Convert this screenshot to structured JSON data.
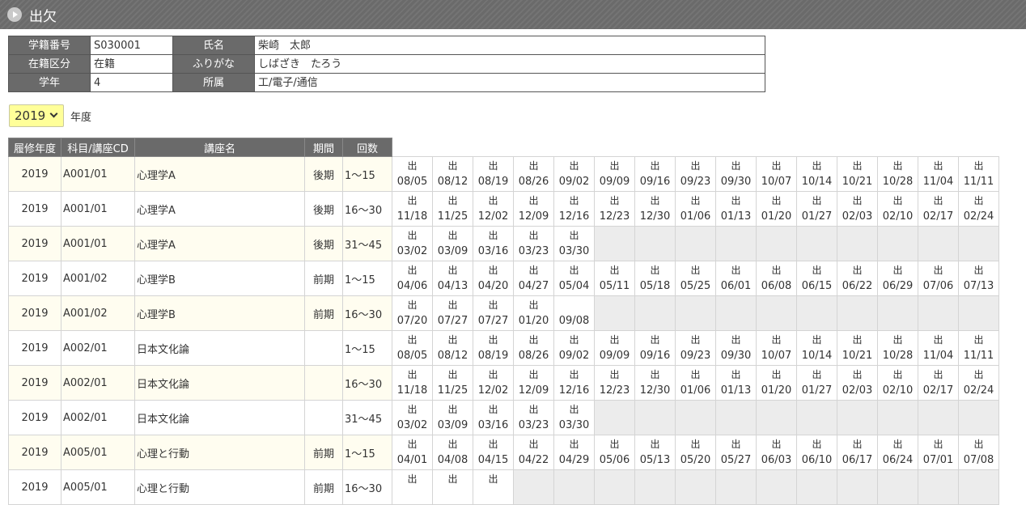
{
  "header": {
    "title": "出欠"
  },
  "student": {
    "id_label": "学籍番号",
    "id": "S030001",
    "name_label": "氏名",
    "name": "柴崎　太郎",
    "status_label": "在籍区分",
    "status": "在籍",
    "kana_label": "ふりがな",
    "kana": "しばざき　たろう",
    "grade_label": "学年",
    "grade": "4",
    "affiliation_label": "所属",
    "affiliation": "工/電子/通信"
  },
  "year_select": {
    "value": "2019",
    "label": "年度"
  },
  "table": {
    "headers": [
      "履修年度",
      "科目/講座CD",
      "講座名",
      "期間",
      "回数"
    ],
    "rows": [
      {
        "year": "2019",
        "code": "A001/01",
        "name": "心理学A",
        "term": "後期",
        "range": "1～15",
        "marks": [
          [
            "出",
            "08/05"
          ],
          [
            "出",
            "08/12"
          ],
          [
            "出",
            "08/19"
          ],
          [
            "出",
            "08/26"
          ],
          [
            "出",
            "09/02"
          ],
          [
            "出",
            "09/09"
          ],
          [
            "出",
            "09/16"
          ],
          [
            "出",
            "09/23"
          ],
          [
            "出",
            "09/30"
          ],
          [
            "出",
            "10/07"
          ],
          [
            "出",
            "10/14"
          ],
          [
            "出",
            "10/21"
          ],
          [
            "出",
            "10/28"
          ],
          [
            "出",
            "11/04"
          ],
          [
            "出",
            "11/11"
          ]
        ]
      },
      {
        "year": "2019",
        "code": "A001/01",
        "name": "心理学A",
        "term": "後期",
        "range": "16～30",
        "marks": [
          [
            "出",
            "11/18"
          ],
          [
            "出",
            "11/25"
          ],
          [
            "出",
            "12/02"
          ],
          [
            "出",
            "12/09"
          ],
          [
            "出",
            "12/16"
          ],
          [
            "出",
            "12/23"
          ],
          [
            "出",
            "12/30"
          ],
          [
            "出",
            "01/06"
          ],
          [
            "出",
            "01/13"
          ],
          [
            "出",
            "01/20"
          ],
          [
            "出",
            "01/27"
          ],
          [
            "出",
            "02/03"
          ],
          [
            "出",
            "02/10"
          ],
          [
            "出",
            "02/17"
          ],
          [
            "出",
            "02/24"
          ]
        ]
      },
      {
        "year": "2019",
        "code": "A001/01",
        "name": "心理学A",
        "term": "後期",
        "range": "31～45",
        "marks": [
          [
            "出",
            "03/02"
          ],
          [
            "出",
            "03/09"
          ],
          [
            "出",
            "03/16"
          ],
          [
            "出",
            "03/23"
          ],
          [
            "出",
            "03/30"
          ]
        ]
      },
      {
        "year": "2019",
        "code": "A001/02",
        "name": "心理学B",
        "term": "前期",
        "range": "1～15",
        "marks": [
          [
            "出",
            "04/06"
          ],
          [
            "出",
            "04/13"
          ],
          [
            "出",
            "04/20"
          ],
          [
            "出",
            "04/27"
          ],
          [
            "出",
            "05/04"
          ],
          [
            "出",
            "05/11"
          ],
          [
            "出",
            "05/18"
          ],
          [
            "出",
            "05/25"
          ],
          [
            "出",
            "06/01"
          ],
          [
            "出",
            "06/08"
          ],
          [
            "出",
            "06/15"
          ],
          [
            "出",
            "06/22"
          ],
          [
            "出",
            "06/29"
          ],
          [
            "出",
            "07/06"
          ],
          [
            "出",
            "07/13"
          ]
        ]
      },
      {
        "year": "2019",
        "code": "A001/02",
        "name": "心理学B",
        "term": "前期",
        "range": "16～30",
        "marks": [
          [
            "出",
            "07/20"
          ],
          [
            "出",
            "07/27"
          ],
          [
            "出",
            "07/27"
          ],
          [
            "出",
            "01/20"
          ],
          [
            "",
            "09/08"
          ]
        ]
      },
      {
        "year": "2019",
        "code": "A002/01",
        "name": "日本文化論",
        "term": "",
        "range": "1～15",
        "marks": [
          [
            "出",
            "08/05"
          ],
          [
            "出",
            "08/12"
          ],
          [
            "出",
            "08/19"
          ],
          [
            "出",
            "08/26"
          ],
          [
            "出",
            "09/02"
          ],
          [
            "出",
            "09/09"
          ],
          [
            "出",
            "09/16"
          ],
          [
            "出",
            "09/23"
          ],
          [
            "出",
            "09/30"
          ],
          [
            "出",
            "10/07"
          ],
          [
            "出",
            "10/14"
          ],
          [
            "出",
            "10/21"
          ],
          [
            "出",
            "10/28"
          ],
          [
            "出",
            "11/04"
          ],
          [
            "出",
            "11/11"
          ]
        ]
      },
      {
        "year": "2019",
        "code": "A002/01",
        "name": "日本文化論",
        "term": "",
        "range": "16～30",
        "marks": [
          [
            "出",
            "11/18"
          ],
          [
            "出",
            "11/25"
          ],
          [
            "出",
            "12/02"
          ],
          [
            "出",
            "12/09"
          ],
          [
            "出",
            "12/16"
          ],
          [
            "出",
            "12/23"
          ],
          [
            "出",
            "12/30"
          ],
          [
            "出",
            "01/06"
          ],
          [
            "出",
            "01/13"
          ],
          [
            "出",
            "01/20"
          ],
          [
            "出",
            "01/27"
          ],
          [
            "出",
            "02/03"
          ],
          [
            "出",
            "02/10"
          ],
          [
            "出",
            "02/17"
          ],
          [
            "出",
            "02/24"
          ]
        ]
      },
      {
        "year": "2019",
        "code": "A002/01",
        "name": "日本文化論",
        "term": "",
        "range": "31～45",
        "marks": [
          [
            "出",
            "03/02"
          ],
          [
            "出",
            "03/09"
          ],
          [
            "出",
            "03/16"
          ],
          [
            "出",
            "03/23"
          ],
          [
            "出",
            "03/30"
          ]
        ]
      },
      {
        "year": "2019",
        "code": "A005/01",
        "name": "心理と行動",
        "term": "前期",
        "range": "1～15",
        "marks": [
          [
            "出",
            "04/01"
          ],
          [
            "出",
            "04/08"
          ],
          [
            "出",
            "04/15"
          ],
          [
            "出",
            "04/22"
          ],
          [
            "出",
            "04/29"
          ],
          [
            "出",
            "05/06"
          ],
          [
            "出",
            "05/13"
          ],
          [
            "出",
            "05/20"
          ],
          [
            "出",
            "05/27"
          ],
          [
            "出",
            "06/03"
          ],
          [
            "出",
            "06/10"
          ],
          [
            "出",
            "06/17"
          ],
          [
            "出",
            "06/24"
          ],
          [
            "出",
            "07/01"
          ],
          [
            "出",
            "07/08"
          ]
        ]
      },
      {
        "year": "2019",
        "code": "A005/01",
        "name": "心理と行動",
        "term": "前期",
        "range": "16～30",
        "marks": [
          [
            "出",
            ""
          ],
          [
            "出",
            ""
          ],
          [
            "出",
            ""
          ]
        ]
      }
    ]
  }
}
